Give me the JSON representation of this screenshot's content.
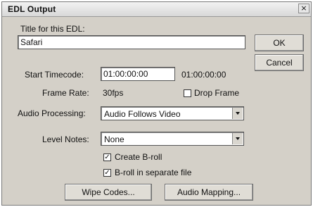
{
  "dialog": {
    "title": "EDL Output",
    "close_glyph": "×"
  },
  "title_field": {
    "label": "Title for this EDL:",
    "value": "Safari"
  },
  "buttons": {
    "ok": "OK",
    "cancel": "Cancel",
    "wipe_codes": "Wipe Codes...",
    "audio_mapping": "Audio Mapping..."
  },
  "start_timecode": {
    "label": "Start Timecode:",
    "value": "01:00:00:00",
    "end_value": "01:00:00:00"
  },
  "frame_rate": {
    "label": "Frame Rate:",
    "value": "30fps"
  },
  "drop_frame": {
    "label": "Drop Frame",
    "checked": false
  },
  "audio_processing": {
    "label": "Audio Processing:",
    "selected": "Audio Follows Video"
  },
  "level_notes": {
    "label": "Level Notes:",
    "selected": "None"
  },
  "create_broll": {
    "label": "Create B-roll",
    "checked": true,
    "check_glyph": "✓"
  },
  "broll_separate": {
    "label": "B-roll in separate file",
    "checked": true,
    "check_glyph": "✓"
  }
}
